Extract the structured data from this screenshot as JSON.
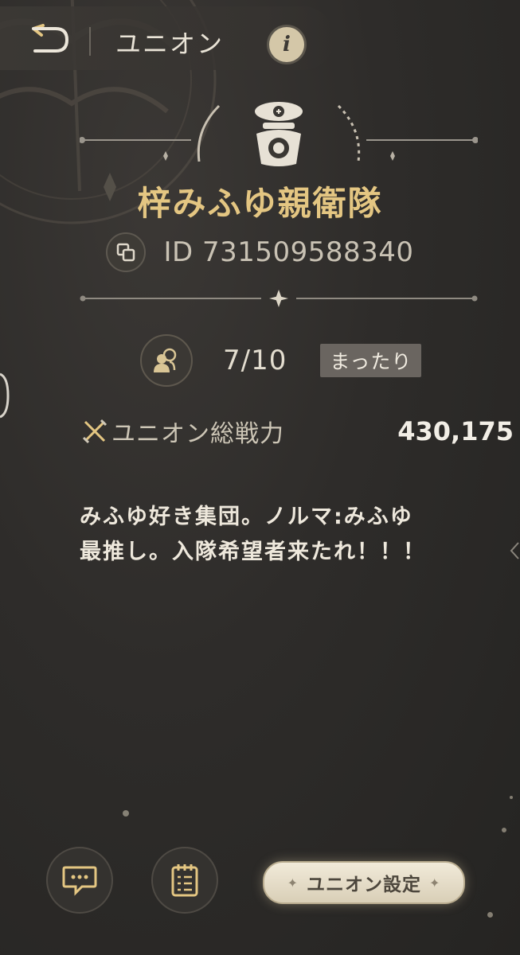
{
  "header": {
    "title": "ユニオン",
    "info_label": "i"
  },
  "icons": {
    "back": "back-arrow-icon",
    "info": "info-icon",
    "copy": "copy-icon",
    "members": "members-icon",
    "power": "crossed-swords-icon",
    "chat": "chat-icon",
    "notes": "notes-icon"
  },
  "union": {
    "name": "梓みふゆ親衛隊",
    "id_text": "ID 731509588340",
    "members": "7/10",
    "style_badge": "まったり",
    "power_label": "ユニオン総戦力",
    "power_value": "430,175",
    "description_line1": "みふゆ好き集団。ノルマ:みふゆ",
    "description_line2": "最推し。入隊希望者来たれ！！！"
  },
  "footer": {
    "settings_label": "ユニオン設定"
  },
  "colors": {
    "accent_gold": "#e4c682",
    "background": "#2e2c2a",
    "badge": "#6a6560",
    "settings_button": "#ece4d0"
  }
}
